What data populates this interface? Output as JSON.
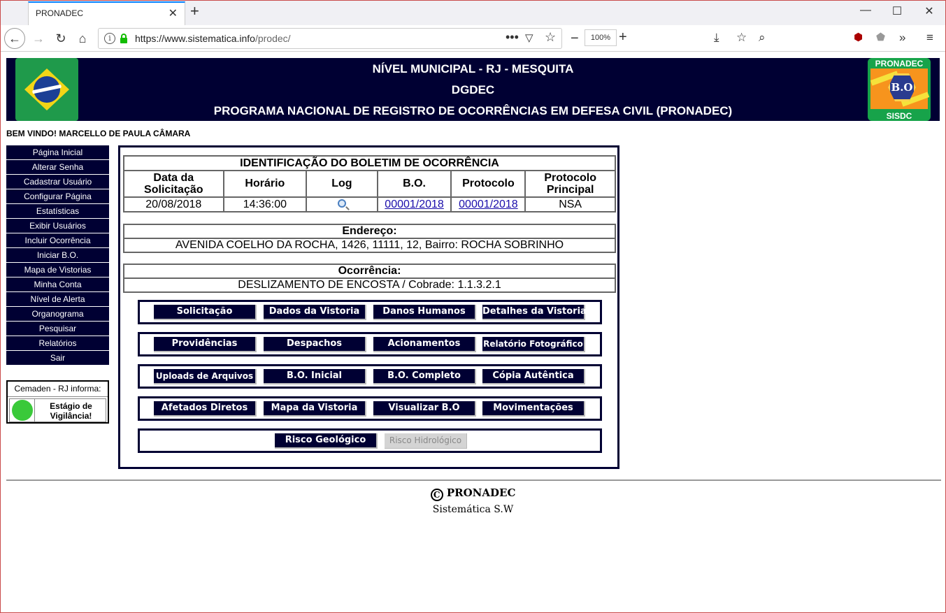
{
  "browser": {
    "tab_title": "PRONADEC",
    "url_host": "https://www.sistematica.info",
    "url_path": "/prodec/",
    "zoom": "100%"
  },
  "header": {
    "line1": "NÍVEL MUNICIPAL - RJ - MESQUITA",
    "line2": "DGDEC",
    "line3": "PROGRAMA NACIONAL DE REGISTRO DE OCORRÊNCIAS EM DEFESA CIVIL (PRONADEC)",
    "logo_top": "PRONADEC",
    "logo_center": "B.O",
    "logo_bottom": "SISDC"
  },
  "welcome": "BEM VINDO! MARCELLO DE PAULA CÂMARA",
  "menu": [
    "Página Inicial",
    "Alterar Senha",
    "Cadastrar Usuário",
    "Configurar Página",
    "Estatísticas",
    "Exibir Usuários",
    "Incluir Ocorrência",
    "Iniciar B.O.",
    "Mapa de Vistorias",
    "Minha Conta",
    "Nível de Alerta",
    "Organograma",
    "Pesquisar",
    "Relatórios",
    "Sair"
  ],
  "cemaden": {
    "title": "Cemaden - RJ informa:",
    "status": "Estágio de Vigilância!",
    "status_color": "#3ac93a"
  },
  "bo": {
    "title": "IDENTIFICAÇÃO DO BOLETIM DE OCORRÊNCIA",
    "headers": [
      "Data da Solicitação",
      "Horário",
      "Log",
      "B.O.",
      "Protocolo",
      "Protocolo Principal"
    ],
    "date": "20/08/2018",
    "time": "14:36:00",
    "log_icon": "magnifier-icon",
    "bo_number": "00001/2018",
    "protocol": "00001/2018",
    "main_protocol": "NSA"
  },
  "address": {
    "label": "Endereço:",
    "value": "AVENIDA COELHO DA ROCHA, 1426, 11111, 12, Bairro: ROCHA SOBRINHO"
  },
  "occurrence": {
    "label": "Ocorrência:",
    "value": "DESLIZAMENTO DE ENCOSTA / Cobrade: 1.1.3.2.1"
  },
  "actions": [
    [
      "Solicitação",
      "Dados da Vistoria",
      "Danos Humanos",
      "Detalhes da Vistoria"
    ],
    [
      "Providências",
      "Despachos",
      "Acionamentos",
      "Relatório Fotográfico"
    ],
    [
      "Uploads de Arquivos",
      "B.O. Inicial",
      "B.O. Completo",
      "Cópia Autêntica"
    ],
    [
      "Afetados Diretos",
      "Mapa da Vistoria",
      "Visualizar B.O",
      "Movimentações"
    ]
  ],
  "risk": [
    "Risco Geológico",
    "Risco Hidrológico"
  ],
  "footer": {
    "brand": "PRONADEC",
    "company": "Sistemática S.W"
  }
}
